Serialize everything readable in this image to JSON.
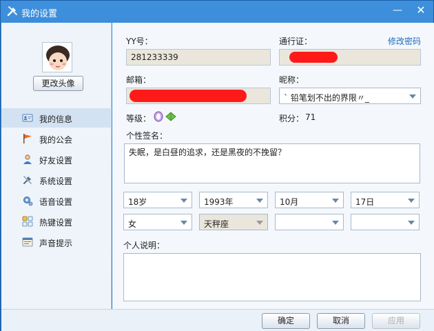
{
  "window": {
    "title": "我的设置",
    "minimize": "—",
    "close": "✕"
  },
  "sidebar": {
    "change_avatar": "更改头像",
    "items": [
      {
        "label": "我的信息",
        "icon": "id-card-icon"
      },
      {
        "label": "我的公会",
        "icon": "flag-icon"
      },
      {
        "label": "好友设置",
        "icon": "user-icon"
      },
      {
        "label": "系统设置",
        "icon": "wrench-icon"
      },
      {
        "label": "语音设置",
        "icon": "voice-settings-icon"
      },
      {
        "label": "热键设置",
        "icon": "keyboard-icon"
      },
      {
        "label": "声音提示",
        "icon": "sound-notice-icon"
      }
    ]
  },
  "form": {
    "yy_label": "YY号：",
    "yy_value": "281233339",
    "passport_label": "通行证：",
    "change_password": "修改密码",
    "email_label": "邮箱：",
    "nickname_label": "昵称：",
    "nickname_value": "ˋ 铅笔划不出的界限〃_",
    "level_label": "等级：",
    "points_label": "积分：",
    "points_value": "71",
    "signature_label": "个性签名：",
    "signature_value": "失眠，是白昼的追求，还是黑夜的不挽留？",
    "age": "18岁",
    "year": "1993年",
    "month": "10月",
    "day": "17日",
    "gender": "女",
    "zodiac": "天秤座",
    "province": "",
    "city": "",
    "intro_label": "个人说明："
  },
  "footer": {
    "ok": "确定",
    "cancel": "取消",
    "apply": "应用"
  },
  "colors": {
    "accent": "#2470c0",
    "link": "#1f6bb8",
    "redaction": "#ff1a1a"
  }
}
